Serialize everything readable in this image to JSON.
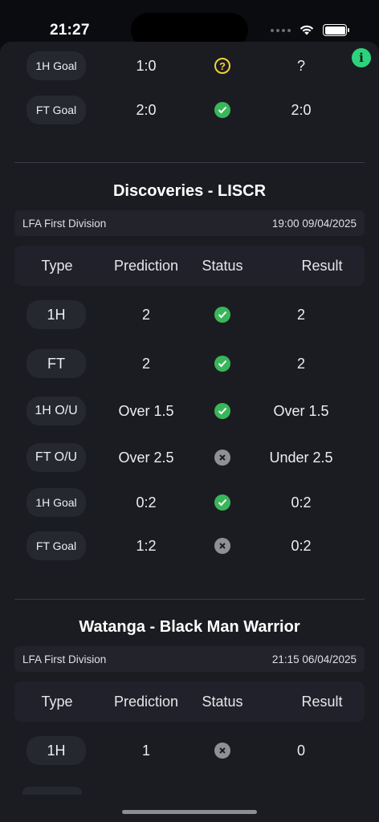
{
  "status_bar": {
    "time": "21:27"
  },
  "columns": {
    "type": "Type",
    "prediction": "Prediction",
    "status": "Status",
    "result": "Result"
  },
  "top_rows": [
    {
      "type": "1H Goal",
      "prediction": "1:0",
      "status": "pending",
      "result": "?"
    },
    {
      "type": "FT Goal",
      "prediction": "2:0",
      "status": "correct",
      "result": "2:0"
    }
  ],
  "matches": [
    {
      "title": "Discoveries - LISCR",
      "league": "LFA First Division",
      "datetime": "19:00 09/04/2025",
      "rows": [
        {
          "type": "1H",
          "prediction": "2",
          "status": "correct",
          "result": "2"
        },
        {
          "type": "FT",
          "prediction": "2",
          "status": "correct",
          "result": "2"
        },
        {
          "type": "1H O/U",
          "prediction": "Over 1.5",
          "status": "correct",
          "result": "Over 1.5"
        },
        {
          "type": "FT O/U",
          "prediction": "Over 2.5",
          "status": "incorrect",
          "result": "Under 2.5"
        },
        {
          "type": "1H Goal",
          "prediction": "0:2",
          "status": "correct",
          "result": "0:2"
        },
        {
          "type": "FT Goal",
          "prediction": "1:2",
          "status": "incorrect",
          "result": "0:2"
        }
      ]
    },
    {
      "title": "Watanga - Black Man Warrior",
      "league": "LFA First Division",
      "datetime": "21:15 06/04/2025",
      "rows": [
        {
          "type": "1H",
          "prediction": "1",
          "status": "incorrect",
          "result": "0"
        }
      ]
    }
  ],
  "colors": {
    "correct": "#39b65a",
    "incorrect": "#8f9096",
    "pending": "#f1d23a",
    "info": "#2fd27c"
  },
  "icons": {
    "correct": "check-icon",
    "incorrect": "x-icon",
    "pending": "question-icon",
    "info": "info-icon"
  }
}
